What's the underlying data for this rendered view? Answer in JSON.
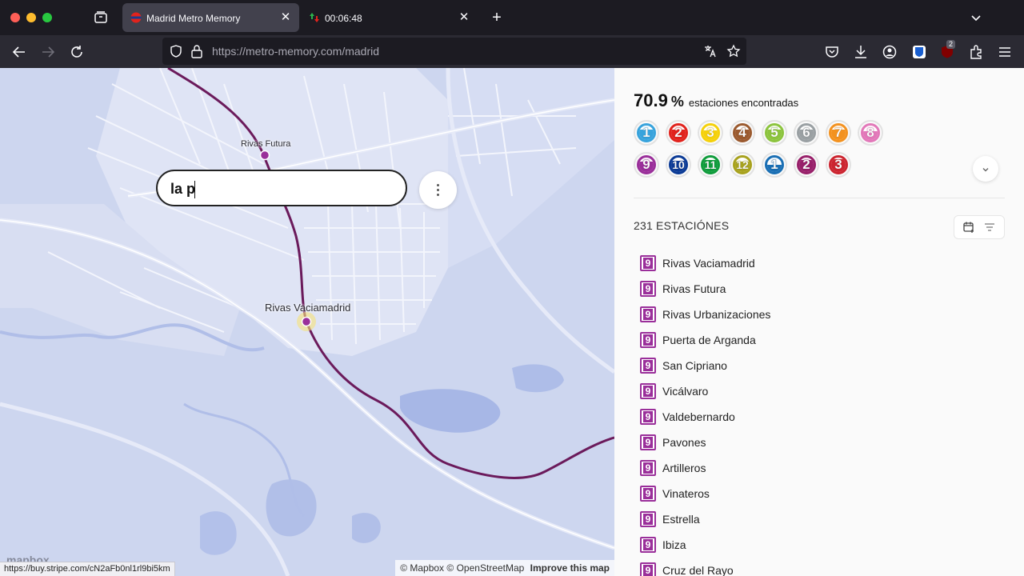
{
  "browser": {
    "tabs": [
      {
        "title": "Madrid Metro Memory",
        "active": true
      },
      {
        "title": "00:06:48",
        "active": false
      }
    ],
    "url_host": "https://metro-memory.com",
    "url_path": "/madrid",
    "status_url": "https://buy.stripe.com/cN2aFb0nl1rl9bi5km",
    "extension_badge": "2"
  },
  "map": {
    "labels": {
      "rivas_futura": "Rivas Futura",
      "rivas_vaciamadrid": "Rivas Vaciamadrid"
    },
    "search_value": "la p",
    "attribution": {
      "mapbox": "© Mapbox",
      "osm": "© OpenStreetMap",
      "improve": "Improve this map"
    },
    "logo": "mapbox",
    "line_color": "#6b1a5b"
  },
  "sidebar": {
    "progress_value": "70.9",
    "progress_unit": "%",
    "progress_label": "estaciones encontradas",
    "lines": [
      {
        "label": "1",
        "color": "#38a3dc",
        "found": 0.75
      },
      {
        "label": "2",
        "color": "#e1231d",
        "found": 0.7
      },
      {
        "label": "3",
        "color": "#f5d10b",
        "found": 0.65
      },
      {
        "label": "4",
        "color": "#9b5a2f",
        "found": 0.75
      },
      {
        "label": "5",
        "color": "#8cc43e",
        "found": 0.7
      },
      {
        "label": "6",
        "color": "#9aa0a3",
        "found": 0.72
      },
      {
        "label": "7",
        "color": "#f39220",
        "found": 0.7
      },
      {
        "label": "8",
        "color": "#e278b9",
        "found": 0.6
      },
      {
        "label": "9",
        "color": "#9a2f9a",
        "found": 0.75
      },
      {
        "label": "10",
        "color": "#0c3b96",
        "found": 0.8
      },
      {
        "label": "11",
        "color": "#109c3c",
        "found": 0.85
      },
      {
        "label": "12",
        "color": "#a8a21e",
        "found": 0.7
      },
      {
        "label": "1",
        "color": "#1a6fb4",
        "found": 0.5
      },
      {
        "label": "2",
        "color": "#98206a",
        "found": 0.85
      },
      {
        "label": "3",
        "color": "#cc2530",
        "found": 0.9
      }
    ],
    "station_count": "231 ESTACIÓNES",
    "stations": [
      {
        "line": "9",
        "name": "Rivas Vaciamadrid"
      },
      {
        "line": "9",
        "name": "Rivas Futura"
      },
      {
        "line": "9",
        "name": "Rivas Urbanizaciones"
      },
      {
        "line": "9",
        "name": "Puerta de Arganda"
      },
      {
        "line": "9",
        "name": "San Cipriano"
      },
      {
        "line": "9",
        "name": "Vicálvaro"
      },
      {
        "line": "9",
        "name": "Valdebernardo"
      },
      {
        "line": "9",
        "name": "Pavones"
      },
      {
        "line": "9",
        "name": "Artilleros"
      },
      {
        "line": "9",
        "name": "Vinateros"
      },
      {
        "line": "9",
        "name": "Estrella"
      },
      {
        "line": "9",
        "name": "Ibiza"
      },
      {
        "line": "9",
        "name": "Cruz del Rayo"
      }
    ]
  }
}
